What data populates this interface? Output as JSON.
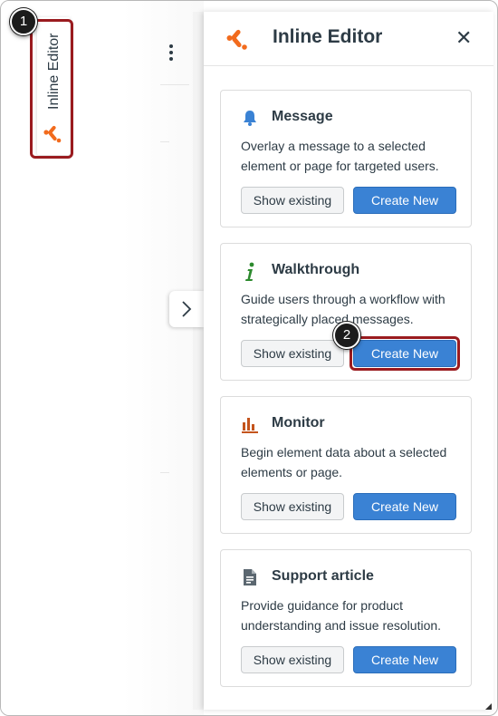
{
  "side_tab": {
    "label": "Inline Editor"
  },
  "callouts": [
    "1",
    "2"
  ],
  "panel": {
    "title": "Inline Editor",
    "close_glyph": "✕"
  },
  "cards": [
    {
      "title": "Message",
      "icon": "bell-icon",
      "description": "Overlay a message to a selected element or page for targeted users.",
      "secondary": "Show existing",
      "primary": "Create New"
    },
    {
      "title": "Walkthrough",
      "icon": "info-icon",
      "description": "Guide users through a workflow with strategically placed messages.",
      "secondary": "Show existing",
      "primary": "Create New"
    },
    {
      "title": "Monitor",
      "icon": "bar-chart-icon",
      "description": "Begin element data about a selected elements or page.",
      "secondary": "Show existing",
      "primary": "Create New"
    },
    {
      "title": "Support article",
      "icon": "document-icon",
      "description": "Provide guidance for product understanding and issue resolution.",
      "secondary": "Show existing",
      "primary": "Create New"
    }
  ],
  "colors": {
    "brand_orange": "#f26b1d",
    "primary_blue": "#3a82d4",
    "highlight_red": "#9a1b1f",
    "info_green": "#2d8a2e",
    "icon_blue": "#3a82d4",
    "chart_orange": "#c4541c"
  }
}
